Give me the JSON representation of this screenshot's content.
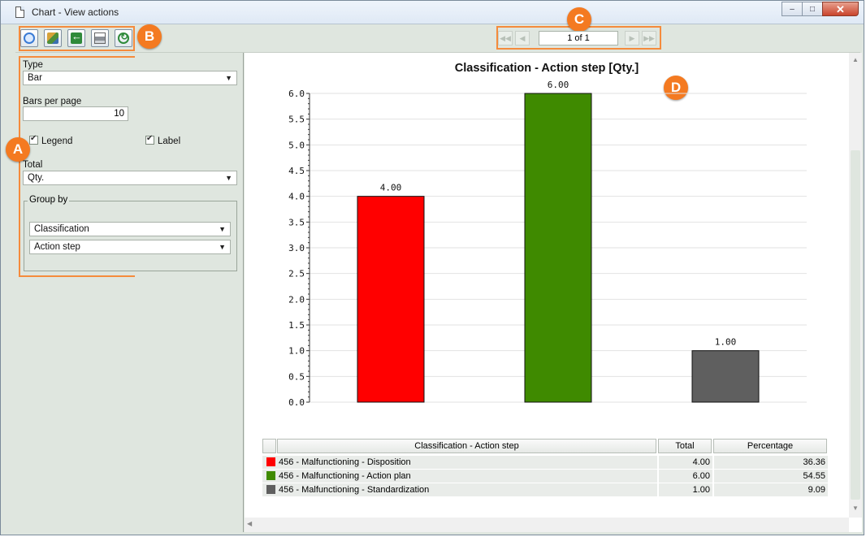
{
  "window": {
    "title": "Chart - View actions",
    "controls": [
      "minimize",
      "maximize",
      "close"
    ]
  },
  "toolbar": {
    "buttons": [
      {
        "name": "print-preview",
        "icon": "magnifier-page-icon"
      },
      {
        "name": "layers",
        "icon": "layers-icon"
      },
      {
        "name": "back",
        "icon": "back-arrow-icon"
      },
      {
        "name": "print",
        "icon": "printer-icon"
      },
      {
        "name": "refresh",
        "icon": "refresh-icon"
      }
    ]
  },
  "pager": {
    "value": "1 of 1"
  },
  "callouts": {
    "a": "A",
    "b": "B",
    "c": "C",
    "d": "D"
  },
  "options": {
    "type_label": "Type",
    "type_value": "Bar",
    "bars_per_page_label": "Bars per page",
    "bars_per_page_value": "10",
    "legend_label": "Legend",
    "legend_checked": true,
    "label_label": "Label",
    "label_checked": true,
    "total_label": "Total",
    "total_value": "Qty.",
    "group_by_label": "Group by",
    "group_by_1": "Classification",
    "group_by_2": "Action step"
  },
  "chart_data": {
    "type": "bar",
    "title": "Classification - Action step [Qty.]",
    "xlabel": "",
    "ylabel": "",
    "ylim": [
      0,
      6
    ],
    "yticks": [
      "0.0",
      "0.5",
      "1.0",
      "1.5",
      "2.0",
      "2.5",
      "3.0",
      "3.5",
      "4.0",
      "4.5",
      "5.0",
      "5.5",
      "6.0"
    ],
    "categories": [
      "456 - Malfunctioning - Disposition",
      "456 - Malfunctioning - Action plan",
      "456 - Malfunctioning - Standardization"
    ],
    "values": [
      4,
      6,
      1
    ],
    "value_labels": [
      "4.00",
      "6.00",
      "1.00"
    ],
    "colors": [
      "#ff0000",
      "#3f8a00",
      "#5f5f5f"
    ],
    "grid": true
  },
  "legend_table": {
    "headers": [
      "Classification - Action step",
      "Total",
      "Percentage"
    ],
    "rows": [
      {
        "label": "456 - Malfunctioning - Disposition",
        "total": "4.00",
        "percentage": "36.36",
        "color": "#ff0000"
      },
      {
        "label": "456 - Malfunctioning - Action plan",
        "total": "6.00",
        "percentage": "54.55",
        "color": "#3f8a00"
      },
      {
        "label": "456 - Malfunctioning - Standardization",
        "total": "1.00",
        "percentage": "9.09",
        "color": "#5f5f5f"
      }
    ]
  }
}
